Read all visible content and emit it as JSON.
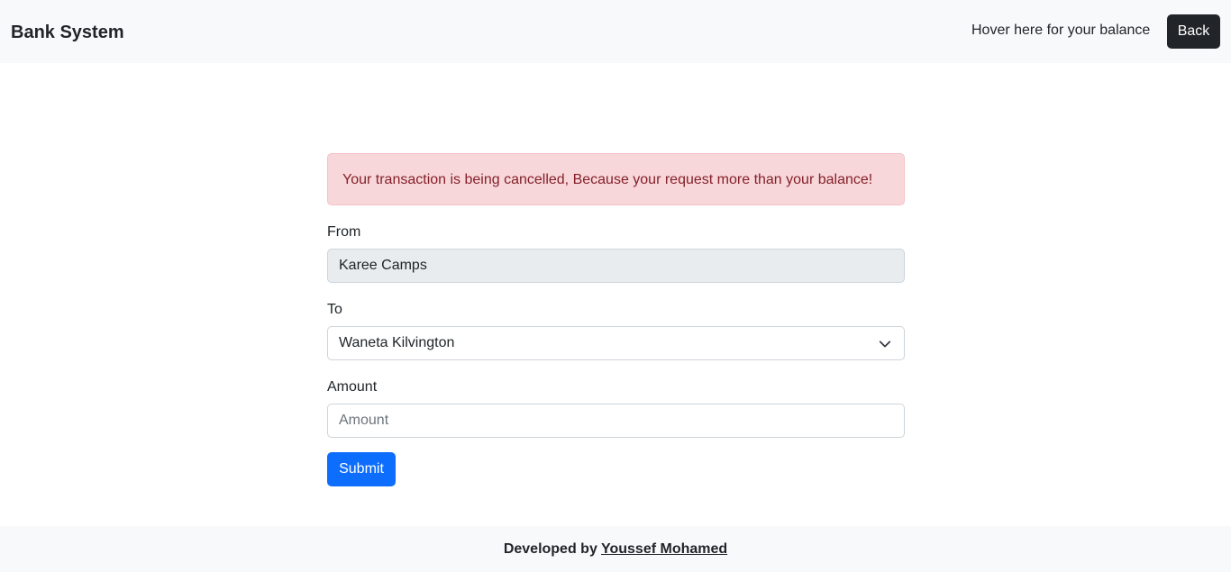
{
  "navbar": {
    "brand": "Bank System",
    "balance_hint": "Hover here for your balance",
    "back_label": "Back"
  },
  "alert": {
    "message": "Your transaction is being cancelled, Because your request more than your balance!"
  },
  "form": {
    "from_label": "From",
    "from_value": "Karee Camps",
    "to_label": "To",
    "to_selected": "Waneta Kilvington",
    "amount_label": "Amount",
    "amount_placeholder": "Amount",
    "submit_label": "Submit"
  },
  "footer": {
    "prefix": "Developed by",
    "author": "Youssef Mohamed"
  },
  "icons": {
    "select_arrow": "chevron-down-icon"
  },
  "colors": {
    "primary": "#0d6efd",
    "dark": "#212529",
    "alert_bg": "#f8d7da",
    "alert_text": "#842029"
  }
}
